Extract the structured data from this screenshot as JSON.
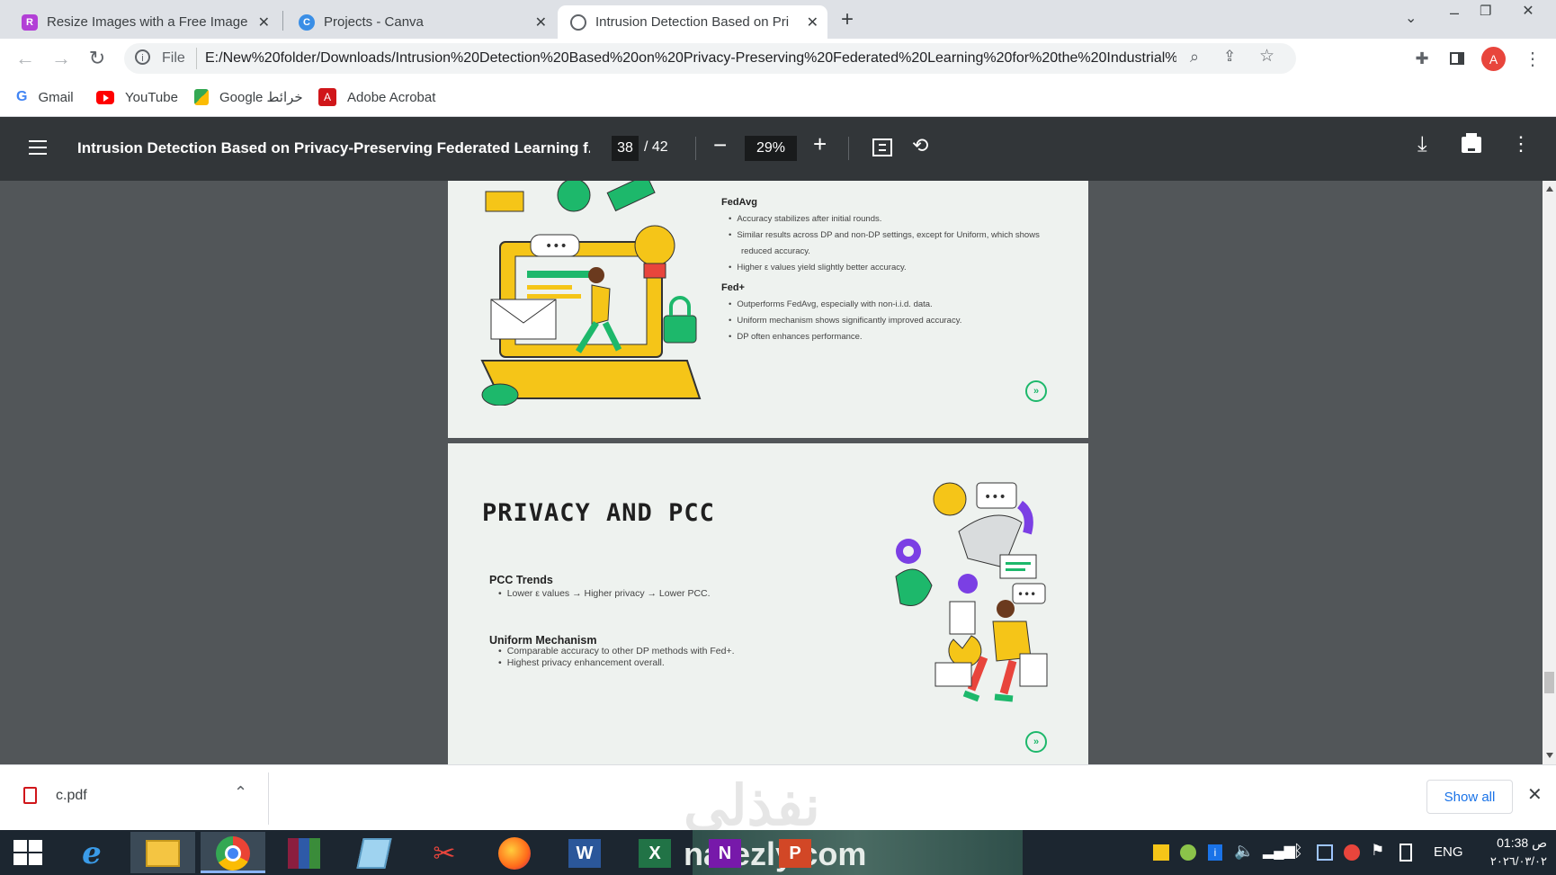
{
  "browser": {
    "tabs": [
      {
        "title": "Resize Images with a Free Image",
        "favicon": "resize-favicon"
      },
      {
        "title": "Projects - Canva",
        "favicon": "canva-favicon"
      },
      {
        "title": "Intrusion Detection Based on Pri",
        "favicon": "globe-favicon"
      }
    ],
    "new_tab": "+",
    "address_scheme": "File",
    "address": "E:/New%20folder/Downloads/Intrusion%20Detection%20Based%20on%20Privacy-Preserving%20Federated%20Learning%20for%20the%20Industrial%2...",
    "profile_initial": "A",
    "bookmarks": [
      "Gmail",
      "YouTube",
      "Google خرائط",
      "Adobe Acrobat"
    ]
  },
  "pdf": {
    "title": "Intrusion Detection Based on Privacy-Preserving Federated Learning f...",
    "current_page": "38",
    "total_pages": "/ 42",
    "zoom": "29%"
  },
  "slide1": {
    "heading1": "FedAvg",
    "bullets1": [
      "Accuracy stabilizes after initial rounds.",
      "Similar results across DP and non-DP settings, except for Uniform, which shows",
      "reduced accuracy.",
      "Higher ε values yield slightly better accuracy."
    ],
    "heading2": "Fed+",
    "bullets2": [
      "Outperforms FedAvg, especially with non-i.i.d. data.",
      "Uniform mechanism shows significantly improved accuracy.",
      "DP often enhances performance."
    ]
  },
  "slide2": {
    "title": "PRIVACY AND PCC",
    "section1_heading": "PCC Trends",
    "section1_bullets": [
      "Lower ε values → Higher privacy → Lower PCC."
    ],
    "section2_heading": "Uniform Mechanism",
    "section2_bullets": [
      "Comparable accuracy to other DP methods with Fed+.",
      "Highest privacy enhancement overall."
    ]
  },
  "download": {
    "file": "c.pdf",
    "show_all": "Show all"
  },
  "watermark": {
    "arabic": "نفذلي",
    "latin": "nafezly.com"
  },
  "taskbar": {
    "lang": "ENG",
    "time": "01:38 ص",
    "date": "٢٠٢٦/٠٣/٠٢"
  },
  "colors": {
    "accent_green": "#1db86b",
    "accent_yellow": "#f5c518",
    "accent_purple": "#7b3fe4",
    "pdf_toolbar": "#323639"
  }
}
